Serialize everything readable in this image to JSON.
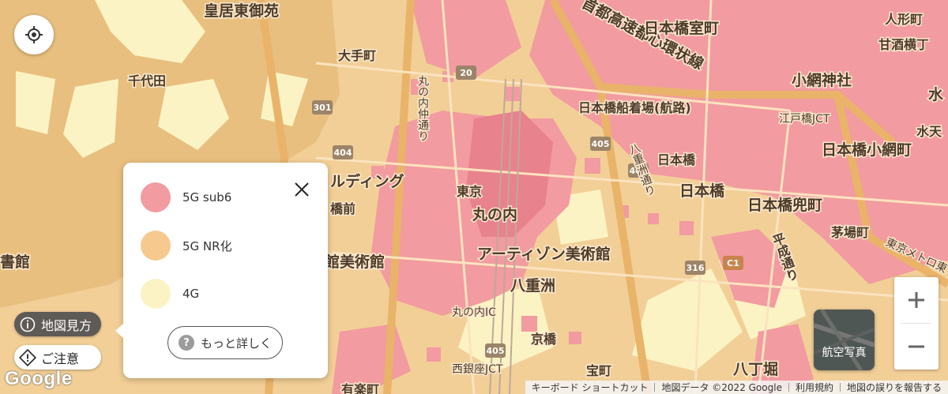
{
  "map": {
    "labels": [
      {
        "text": "皇居東御苑",
        "size": "big"
      },
      {
        "text": "千代田",
        "size": "mid"
      },
      {
        "text": "大手町",
        "size": "mid"
      },
      {
        "text": "首都高速都心環状線",
        "size": "big"
      },
      {
        "text": "日本橋室町",
        "size": "big"
      },
      {
        "text": "人形町",
        "size": "mid"
      },
      {
        "text": "甘酒横丁",
        "size": "mid"
      },
      {
        "text": "小網神社",
        "size": "big"
      },
      {
        "text": "水",
        "size": "big"
      },
      {
        "text": "日本橋船着場(航路)",
        "size": "mid"
      },
      {
        "text": "江戸橋JCT",
        "size": "sm"
      },
      {
        "text": "水天",
        "size": "mid"
      },
      {
        "text": "日本橋小網町",
        "size": "big"
      },
      {
        "text": "丸の内仲通り",
        "size": "sm"
      },
      {
        "text": "ルディング",
        "size": "big"
      },
      {
        "text": "東京",
        "size": "mid"
      },
      {
        "text": "丸の内",
        "size": "big"
      },
      {
        "text": "八重洲通り",
        "size": "sm"
      },
      {
        "text": "日本橋",
        "size": "mid"
      },
      {
        "text": "日本橋",
        "size": "big"
      },
      {
        "text": "日本橋兜町",
        "size": "big"
      },
      {
        "text": "茅場町",
        "size": "mid"
      },
      {
        "text": "橋前",
        "size": "mid"
      },
      {
        "text": "アーティゾン美術館",
        "size": "big"
      },
      {
        "text": "号館美術館",
        "size": "big"
      },
      {
        "text": "平成通り",
        "size": "mid"
      },
      {
        "text": "東京メトロ東",
        "size": "sm"
      },
      {
        "text": "書館",
        "size": "big"
      },
      {
        "text": "八重洲",
        "size": "big"
      },
      {
        "text": "丸の内IC",
        "size": "sm"
      },
      {
        "text": "京橋",
        "size": "mid"
      },
      {
        "text": "西銀座JCT",
        "size": "sm"
      },
      {
        "text": "宝町",
        "size": "mid"
      },
      {
        "text": "八丁堀",
        "size": "big"
      },
      {
        "text": "有楽町",
        "size": "mid"
      }
    ],
    "route_shields": [
      "20",
      "301",
      "404",
      "405",
      "405",
      "316",
      "C1",
      "405"
    ],
    "colors": {
      "sub6": "#f29ba0",
      "nr": "#f6c98e",
      "lte": "#fbf3c4"
    }
  },
  "controls": {
    "locate_icon": "crosshair-icon",
    "howto_label": "地図見方",
    "caution_label": "ご注意",
    "aerial_label": "航空写真",
    "zoom_in_icon": "plus-icon",
    "zoom_out_icon": "minus-icon"
  },
  "legend": {
    "items": [
      {
        "label": "5G sub6",
        "color": "#f29ba0"
      },
      {
        "label": "5G NR化",
        "color": "#f6c98e"
      },
      {
        "label": "4G",
        "color": "#fbf3c4"
      }
    ],
    "more_label": "もっと詳しく"
  },
  "footer": {
    "logo": "Google",
    "shortcuts": "キーボード ショートカット",
    "map_data": "地図データ ©2022 Google",
    "terms": "利用規約",
    "report": "地図の誤りを報告する"
  }
}
